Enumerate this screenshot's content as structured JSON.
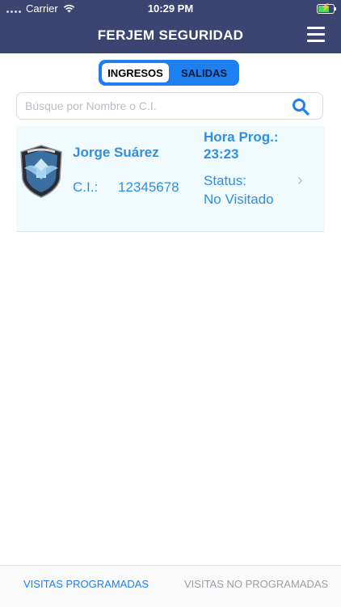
{
  "status_bar": {
    "carrier": "Carrier",
    "time": "10:29 PM",
    "battery_icon": "battery-charging-icon",
    "wifi_icon": "wifi-icon"
  },
  "navbar": {
    "title": "FERJEM SEGURIDAD",
    "menu_icon": "hamburger-menu-icon"
  },
  "segments": {
    "items": [
      "INGRESOS",
      "SALIDAS"
    ],
    "selected": "INGRESOS"
  },
  "search": {
    "placeholder": "Búsque por Nombre o C.I.",
    "value": "",
    "icon": "search-icon"
  },
  "visits": [
    {
      "name": "Jorge Suárez",
      "ci_label": "C.I.:",
      "ci_value": "12345678",
      "hora_label": "Hora Prog.:",
      "hora_value": "23:23",
      "status_label": "Status:",
      "status_value": "No Visitado"
    }
  ],
  "tabbar": {
    "items": [
      "VISITAS PROGRAMADAS",
      "VISITAS NO PROGRAMADAS"
    ],
    "selected": "VISITAS PROGRAMADAS"
  },
  "colors": {
    "nav_bg": "#3c4472",
    "accent": "#1d7ff0",
    "text_blue": "#2f8fe0",
    "card_bg": "#f1fafc"
  }
}
